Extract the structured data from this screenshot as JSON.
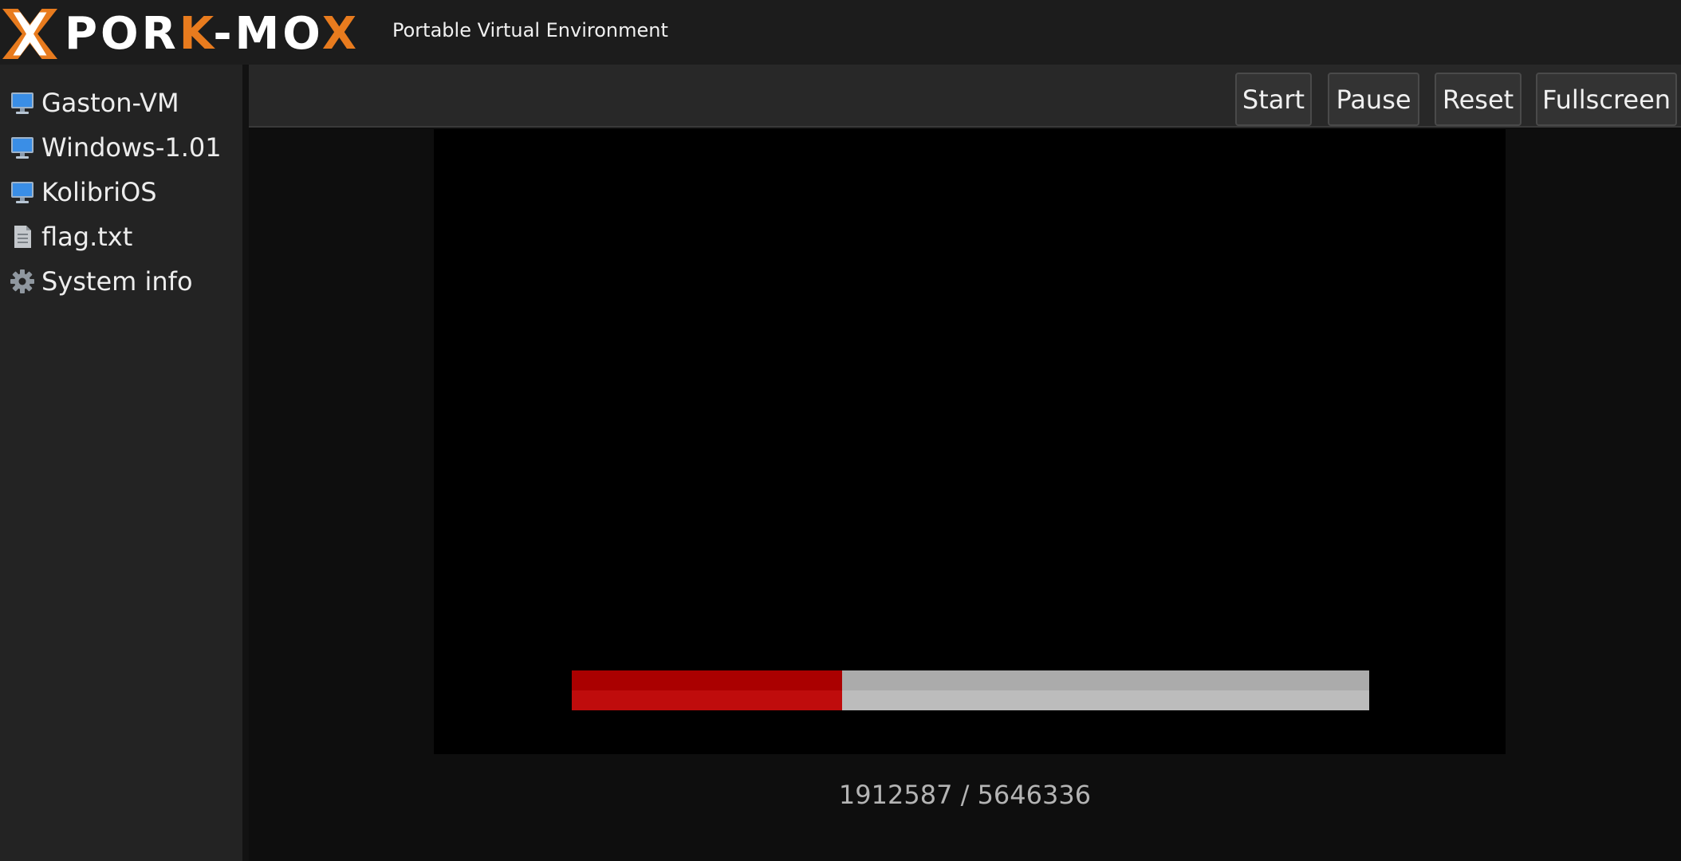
{
  "header": {
    "logo_parts": [
      "POR",
      "K",
      "-MO",
      "X"
    ],
    "logo_colors": {
      "main": "#ffffff",
      "accent": "#e87b1e"
    },
    "subtitle": "Portable Virtual Environment"
  },
  "sidebar": {
    "items": [
      {
        "label": "Gaston-VM",
        "icon": "monitor-icon"
      },
      {
        "label": "Windows-1.01",
        "icon": "monitor-icon"
      },
      {
        "label": "KolibriOS",
        "icon": "monitor-icon"
      },
      {
        "label": "flag.txt",
        "icon": "document-icon"
      },
      {
        "label": "System info",
        "icon": "gear-icon"
      }
    ]
  },
  "toolbar": {
    "start_label": "Start",
    "pause_label": "Pause",
    "reset_label": "Reset",
    "fullscreen_label": "Fullscreen"
  },
  "progress": {
    "loaded": 1912587,
    "total": 5646336,
    "fill_color": "#bf0c0c",
    "track_color": "#bcbcbc"
  },
  "counter_text": "1912587 / 5646336"
}
